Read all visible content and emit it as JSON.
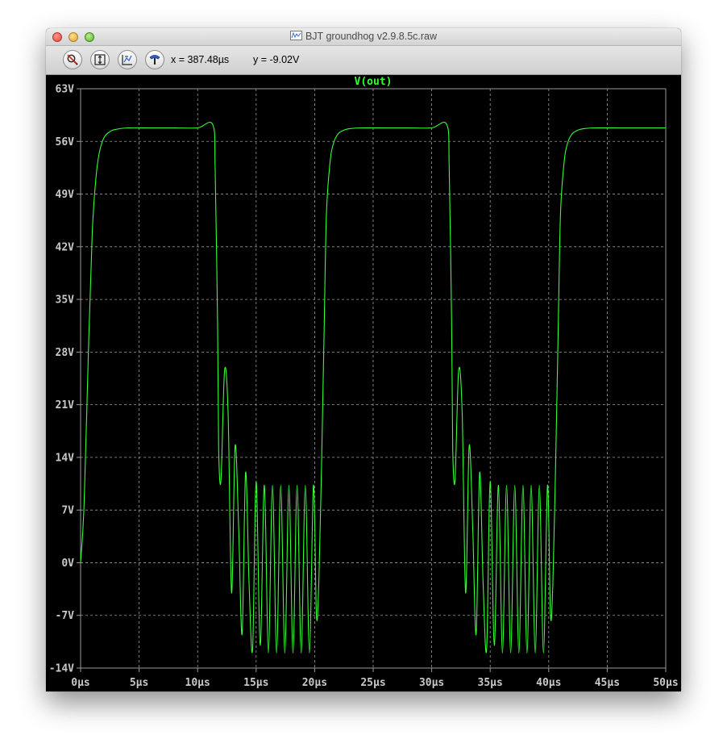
{
  "window": {
    "title": "BJT groundhog v2.9.8.5c.raw"
  },
  "toolbar": {
    "buttons": [
      {
        "icon": "zoom-cancel-icon"
      },
      {
        "icon": "zoom-full-icon"
      },
      {
        "icon": "zoom-fit-icon"
      },
      {
        "icon": "probe-tool-icon"
      }
    ],
    "x_readout": "x = 387.48µs",
    "y_readout": "y = -9.02V"
  },
  "colors": {
    "trace": "#33ff33",
    "axis_text": "#c8c8c8",
    "grid": "#9a9a9a",
    "background": "#000000"
  },
  "chart_data": {
    "type": "line",
    "title": "V(out)",
    "xlabel": "",
    "ylabel": "",
    "xlim": [
      0,
      50
    ],
    "ylim": [
      -14,
      63
    ],
    "x_unit": "µs",
    "y_unit": "V",
    "x_ticks": [
      "0µs",
      "5µs",
      "10µs",
      "15µs",
      "20µs",
      "25µs",
      "30µs",
      "35µs",
      "40µs",
      "45µs",
      "50µs"
    ],
    "y_ticks": [
      "63V",
      "56V",
      "49V",
      "42V",
      "35V",
      "28V",
      "21V",
      "14V",
      "7V",
      "0V",
      "-7V",
      "-14V"
    ],
    "grid": true,
    "series": [
      {
        "name": "V(out)",
        "x": [
          0,
          0.3,
          0.7,
          1.0,
          1.3,
          1.6,
          2.0,
          2.5,
          3.0,
          4.0,
          6.0,
          8.0,
          10.0,
          11.3,
          11.5,
          11.7,
          11.8,
          12.0,
          12.3,
          12.6,
          12.9,
          13.2,
          13.5,
          13.8,
          14.1,
          14.4,
          14.7,
          15.0,
          15.35,
          15.7,
          16.05,
          16.4,
          16.75,
          17.1,
          17.45,
          17.8,
          18.15,
          18.5,
          18.85,
          19.2,
          19.55,
          19.9,
          20.15,
          20.35,
          20.55,
          20.8,
          21.0,
          21.3,
          21.6,
          22.0,
          22.5,
          23.0,
          24.0,
          26.0,
          28.0,
          30.0,
          31.3,
          31.5,
          31.7,
          31.8,
          32.0,
          32.3,
          32.6,
          32.9,
          33.2,
          33.5,
          33.8,
          34.1,
          34.4,
          34.7,
          35.0,
          35.35,
          35.7,
          36.05,
          36.4,
          36.75,
          37.1,
          37.45,
          37.8,
          38.15,
          38.5,
          38.85,
          39.2,
          39.55,
          39.9,
          40.15,
          40.35,
          40.55,
          40.8,
          41.0,
          41.3,
          41.6,
          42.0,
          42.5,
          43.0,
          44.0,
          46.0,
          48.0,
          50.0
        ],
        "y": [
          0,
          8,
          30,
          44,
          51,
          54.5,
          56.5,
          57.3,
          57.6,
          57.8,
          57.8,
          57.8,
          57.8,
          58.2,
          52,
          32,
          15,
          11,
          25.5,
          20,
          -4,
          15.5,
          5,
          -9.5,
          12,
          -3,
          -11.5,
          10.8,
          -11,
          10.3,
          -12,
          10.3,
          -12,
          10.3,
          -12,
          10.3,
          -12,
          10.3,
          -12,
          10.3,
          -12,
          10.3,
          -7,
          -3,
          10,
          30,
          46,
          53,
          55.7,
          57,
          57.5,
          57.7,
          57.8,
          57.8,
          57.8,
          57.8,
          58.2,
          52,
          32,
          15,
          11,
          25.5,
          20,
          -4,
          15.5,
          5,
          -9.5,
          12,
          -3,
          -11.5,
          10.8,
          -11,
          10.3,
          -12,
          10.3,
          -12,
          10.3,
          -12,
          10.3,
          -12,
          10.3,
          -12,
          10.3,
          -12,
          10.3,
          -7,
          -3,
          10,
          30,
          46,
          53,
          55.7,
          57,
          57.5,
          57.7,
          57.8,
          57.8,
          57.8,
          57.8
        ]
      }
    ]
  }
}
